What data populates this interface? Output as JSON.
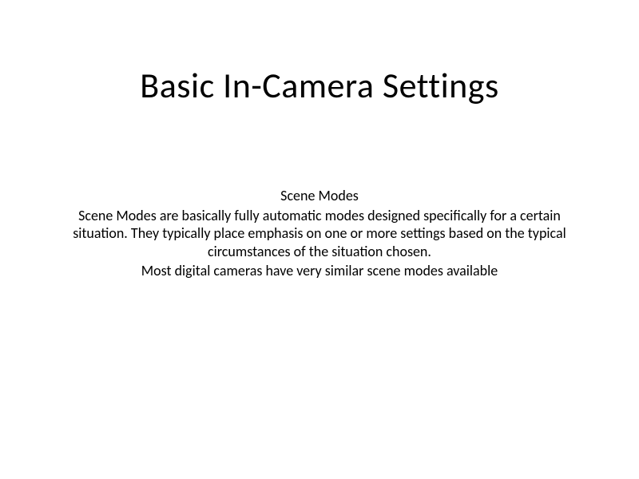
{
  "title": "Basic In-Camera Settings",
  "subtitle": "Scene Modes",
  "paragraph1": "Scene Modes are basically fully automatic modes designed specifically for a certain situation.  They typically place emphasis on one or more settings based on the typical circumstances of the situation chosen.",
  "paragraph2": "Most digital cameras have very similar scene modes available"
}
